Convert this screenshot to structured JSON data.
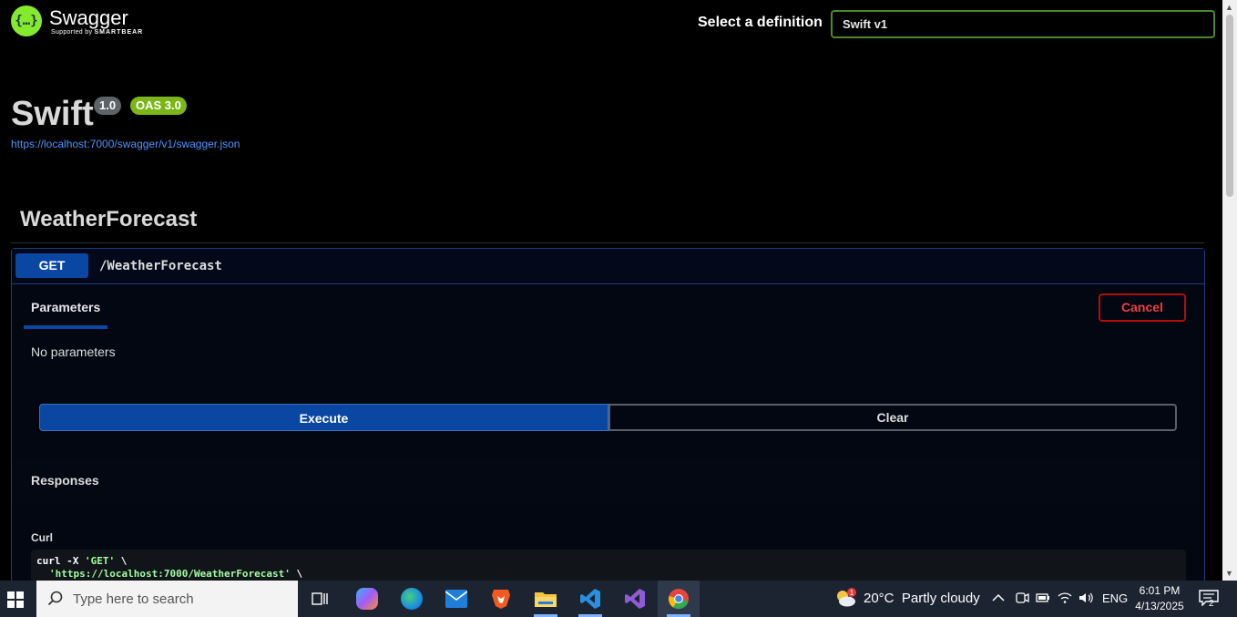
{
  "topbar": {
    "logo_name": "Swagger",
    "logo_sub_prefix": "Supported by",
    "logo_sub_brand": "SMARTBEAR",
    "definition_label": "Select a definition",
    "definition_value": "Swift v1"
  },
  "info": {
    "title": "Swift",
    "version": "1.0",
    "oas": "OAS 3.0",
    "spec_url": "https://localhost:7000/swagger/v1/swagger.json"
  },
  "tag": {
    "name": "WeatherForecast"
  },
  "operation": {
    "method": "GET",
    "path": "/WeatherForecast",
    "params_tab": "Parameters",
    "cancel_label": "Cancel",
    "no_params": "No parameters",
    "execute_label": "Execute",
    "clear_label": "Clear",
    "responses_label": "Responses",
    "curl_label": "Curl",
    "curl_line1_cmd": "curl -X ",
    "curl_line1_method": "'GET'",
    "curl_line1_tail": " \\",
    "curl_line2_url": "'https://localhost:7000/WeatherForecast'",
    "curl_line2_tail": " \\"
  },
  "taskbar": {
    "search_placeholder": "Type here to search",
    "apps": [
      {
        "name": "task-view",
        "color": "#ffffff"
      },
      {
        "name": "copilot",
        "color": "#7a5af8"
      },
      {
        "name": "edge",
        "color": "#1fa3e0"
      },
      {
        "name": "mail",
        "color": "#2a8ae0"
      },
      {
        "name": "brave",
        "color": "#f25a22"
      },
      {
        "name": "file-explorer",
        "color": "#f5c542"
      },
      {
        "name": "vscode",
        "color": "#2a8fe0"
      },
      {
        "name": "visual-studio",
        "color": "#8f5cd6"
      },
      {
        "name": "chrome",
        "color": "#e8453c"
      }
    ],
    "weather_temp": "20°C",
    "weather_desc": "Partly cloudy",
    "weather_badge": "1",
    "language": "ENG",
    "time": "6:01 PM",
    "date": "4/13/2025",
    "notification_count": "2"
  }
}
